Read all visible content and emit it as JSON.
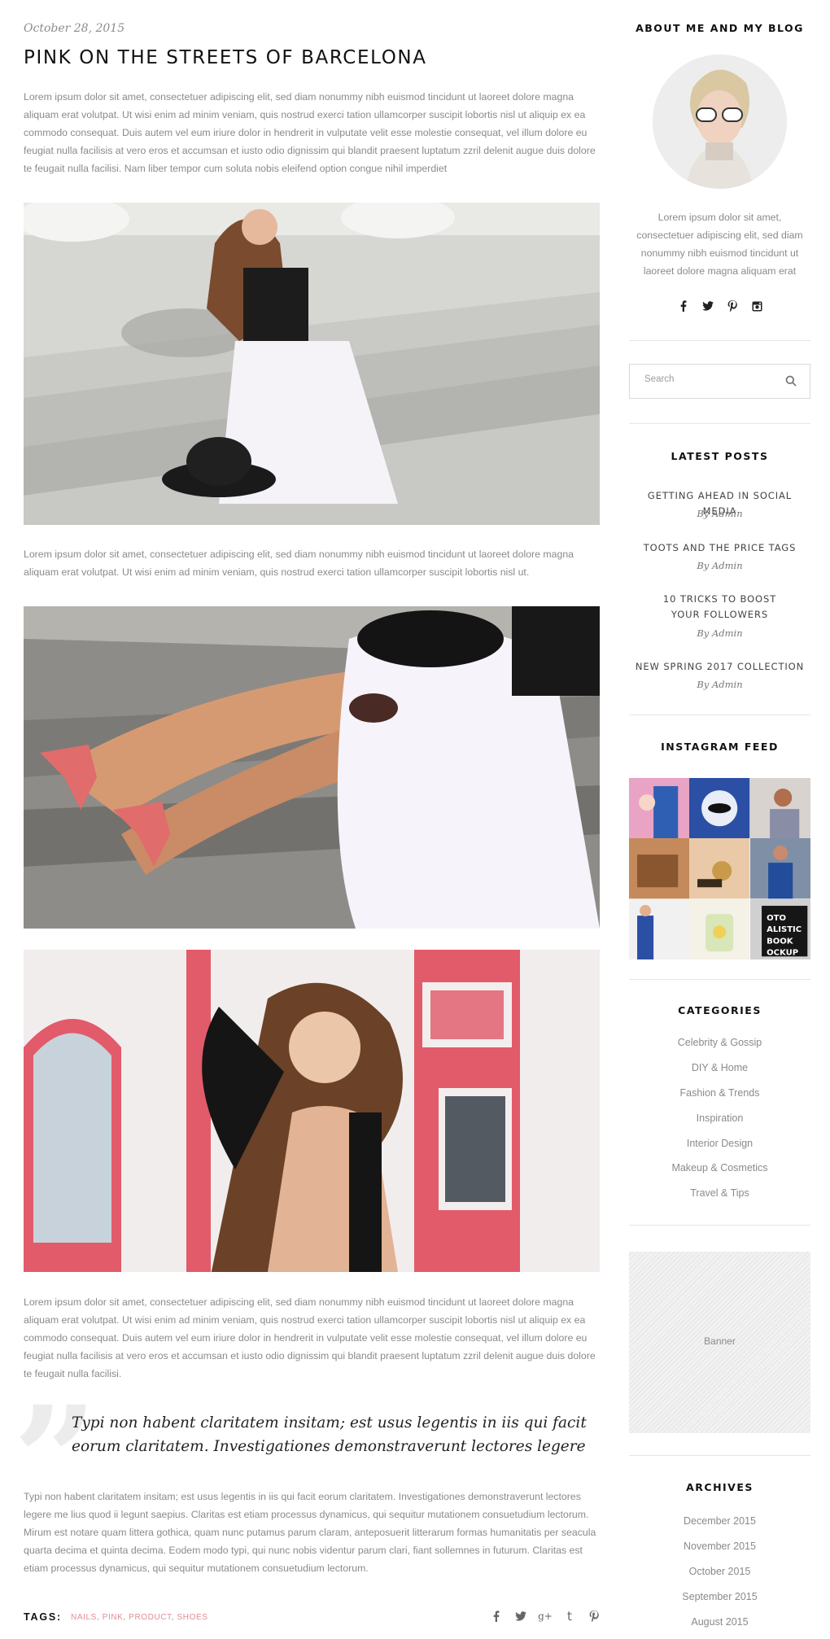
{
  "post": {
    "date": "October 28, 2015",
    "title": "PINK ON THE STREETS OF BARCELONA",
    "para1": "Lorem ipsum dolor sit amet, consectetuer adipiscing elit, sed diam nonummy nibh euismod tincidunt ut laoreet dolore magna aliquam erat volutpat. Ut wisi enim ad minim veniam, quis nostrud exerci tation ullamcorper suscipit lobortis nisl ut aliquip ex ea commodo consequat. Duis autem vel eum iriure dolor in hendrerit in vulputate velit esse molestie consequat, vel illum dolore eu feugiat nulla facilisis at vero eros et accumsan et iusto odio dignissim qui blandit praesent luptatum zzril delenit augue duis dolore te feugait nulla facilisi. Nam liber tempor cum soluta nobis eleifend option congue nihil imperdiet",
    "para2": "Lorem ipsum dolor sit amet, consectetuer adipiscing elit, sed diam nonummy nibh euismod tincidunt ut laoreet dolore magna aliquam erat volutpat. Ut wisi enim ad minim veniam, quis nostrud exerci tation ullamcorper suscipit lobortis nisl ut.",
    "para3": "Lorem ipsum dolor sit amet, consectetuer adipiscing elit, sed diam nonummy nibh euismod tincidunt ut laoreet dolore magna aliquam erat volutpat. Ut wisi enim ad minim veniam, quis nostrud exerci tation ullamcorper suscipit lobortis nisl ut aliquip ex ea commodo consequat. Duis autem vel eum iriure dolor in hendrerit in vulputate velit esse molestie consequat, vel illum dolore eu feugiat nulla facilisis at vero eros et accumsan et iusto odio dignissim qui blandit praesent luptatum zzril delenit augue duis dolore te feugait nulla facilisi.",
    "quote": "Typi non habent claritatem insitam; est usus legentis in iis qui facit eorum claritatem. Investigationes demonstraverunt lectores legere",
    "para4": "Typi non habent claritatem insitam; est usus legentis in iis qui facit eorum claritatem. Investigationes demonstraverunt lectores legere me lius quod ii legunt saepius. Claritas est etiam processus dynamicus, qui sequitur mutationem consuetudium lectorum. Mirum est notare quam littera gothica, quam nunc putamus parum claram, anteposuerit litterarum formas humanitatis per seacula quarta decima et quinta decima. Eodem modo typi, qui nunc nobis videntur parum clari, fiant sollemnes in futurum. Claritas est etiam processus dynamicus, qui sequitur mutationem consuetudium lectorum.",
    "tags_label": "TAGS:",
    "tags": [
      "NAILS",
      "PINK",
      "PRODUCT",
      "SHOES"
    ],
    "share_icons": [
      "facebook-icon",
      "twitter-icon",
      "google-plus-icon",
      "tumblr-icon",
      "pinterest-icon"
    ],
    "share_glyphs": [
      "f",
      "t",
      "g+",
      "t",
      "p"
    ]
  },
  "sidebar": {
    "about_title": "ABOUT ME AND MY BLOG",
    "about_text": "Lorem ipsum dolor sit amet, consectetuer adipiscing elit, sed diam nonummy nibh euismod tincidunt ut laoreet dolore magna aliquam erat",
    "social_icons": [
      "facebook-icon",
      "twitter-icon",
      "pinterest-icon",
      "instagram-icon"
    ],
    "search_placeholder": "Search",
    "latest_title": "LATEST POSTS",
    "latest_posts": [
      {
        "title": "GETTING AHEAD IN SOCIAL MEDIA",
        "author": "By Admin"
      },
      {
        "title": "TOOTS AND THE PRICE TAGS",
        "author": "By Admin"
      },
      {
        "title": "10 TRICKS TO BOOST YOUR FOLLOWERS",
        "author": "By Admin"
      },
      {
        "title": "NEW SPRING 2017 COLLECTION",
        "author": "By Admin"
      }
    ],
    "instagram_title": "INSTAGRAM FEED",
    "categories_title": "CATEGORIES",
    "categories": [
      "Celebrity & Gossip",
      "DIY & Home",
      "Fashion & Trends",
      "Inspiration",
      "Interior Design",
      "Makeup & Cosmetics",
      "Travel & Tips"
    ],
    "banner_label": "Banner",
    "archives_title": "ARCHIVES",
    "archives": [
      "December 2015",
      "November 2015",
      "October 2015",
      "September 2015",
      "August 2015"
    ]
  },
  "colors": {
    "accent": "#e38b94",
    "text": "#8a8a8a",
    "heading": "#111111"
  }
}
